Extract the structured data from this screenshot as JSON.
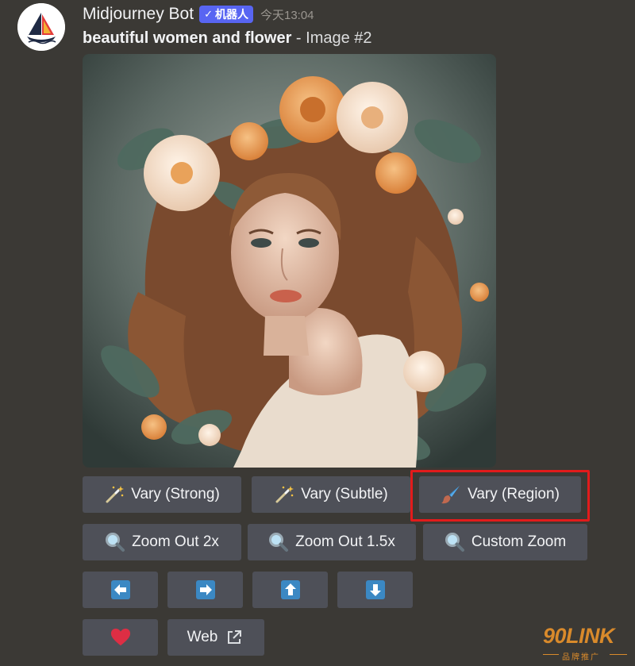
{
  "message": {
    "bot_name": "Midjourney Bot",
    "badge_label": "机器人",
    "timestamp": "今天13:04",
    "prompt_text": "beautiful women and flower",
    "image_suffix": " - Image #2"
  },
  "buttons": {
    "vary_strong": "Vary (Strong)",
    "vary_subtle": "Vary (Subtle)",
    "vary_region": "Vary (Region)",
    "zoom_out_2x": "Zoom Out 2x",
    "zoom_out_1_5x": "Zoom Out 1.5x",
    "custom_zoom": "Custom Zoom",
    "web": "Web"
  },
  "icons": {
    "vary": "magic-wand-icon",
    "region": "paintbrush-icon",
    "zoom": "magnifier-icon",
    "arrows": [
      "arrow-left-icon",
      "arrow-right-icon",
      "arrow-up-icon",
      "arrow-down-icon"
    ],
    "like": "heart-icon",
    "external": "external-link-icon"
  },
  "watermark": {
    "brand": "90LINK",
    "tagline": "品牌推广"
  },
  "colors": {
    "background": "#3b3935",
    "button": "#4e5058",
    "badge": "#5865f2",
    "arrow_button": "#3b88c3",
    "heart": "#dd2e44",
    "highlight": "#e21b1b"
  }
}
